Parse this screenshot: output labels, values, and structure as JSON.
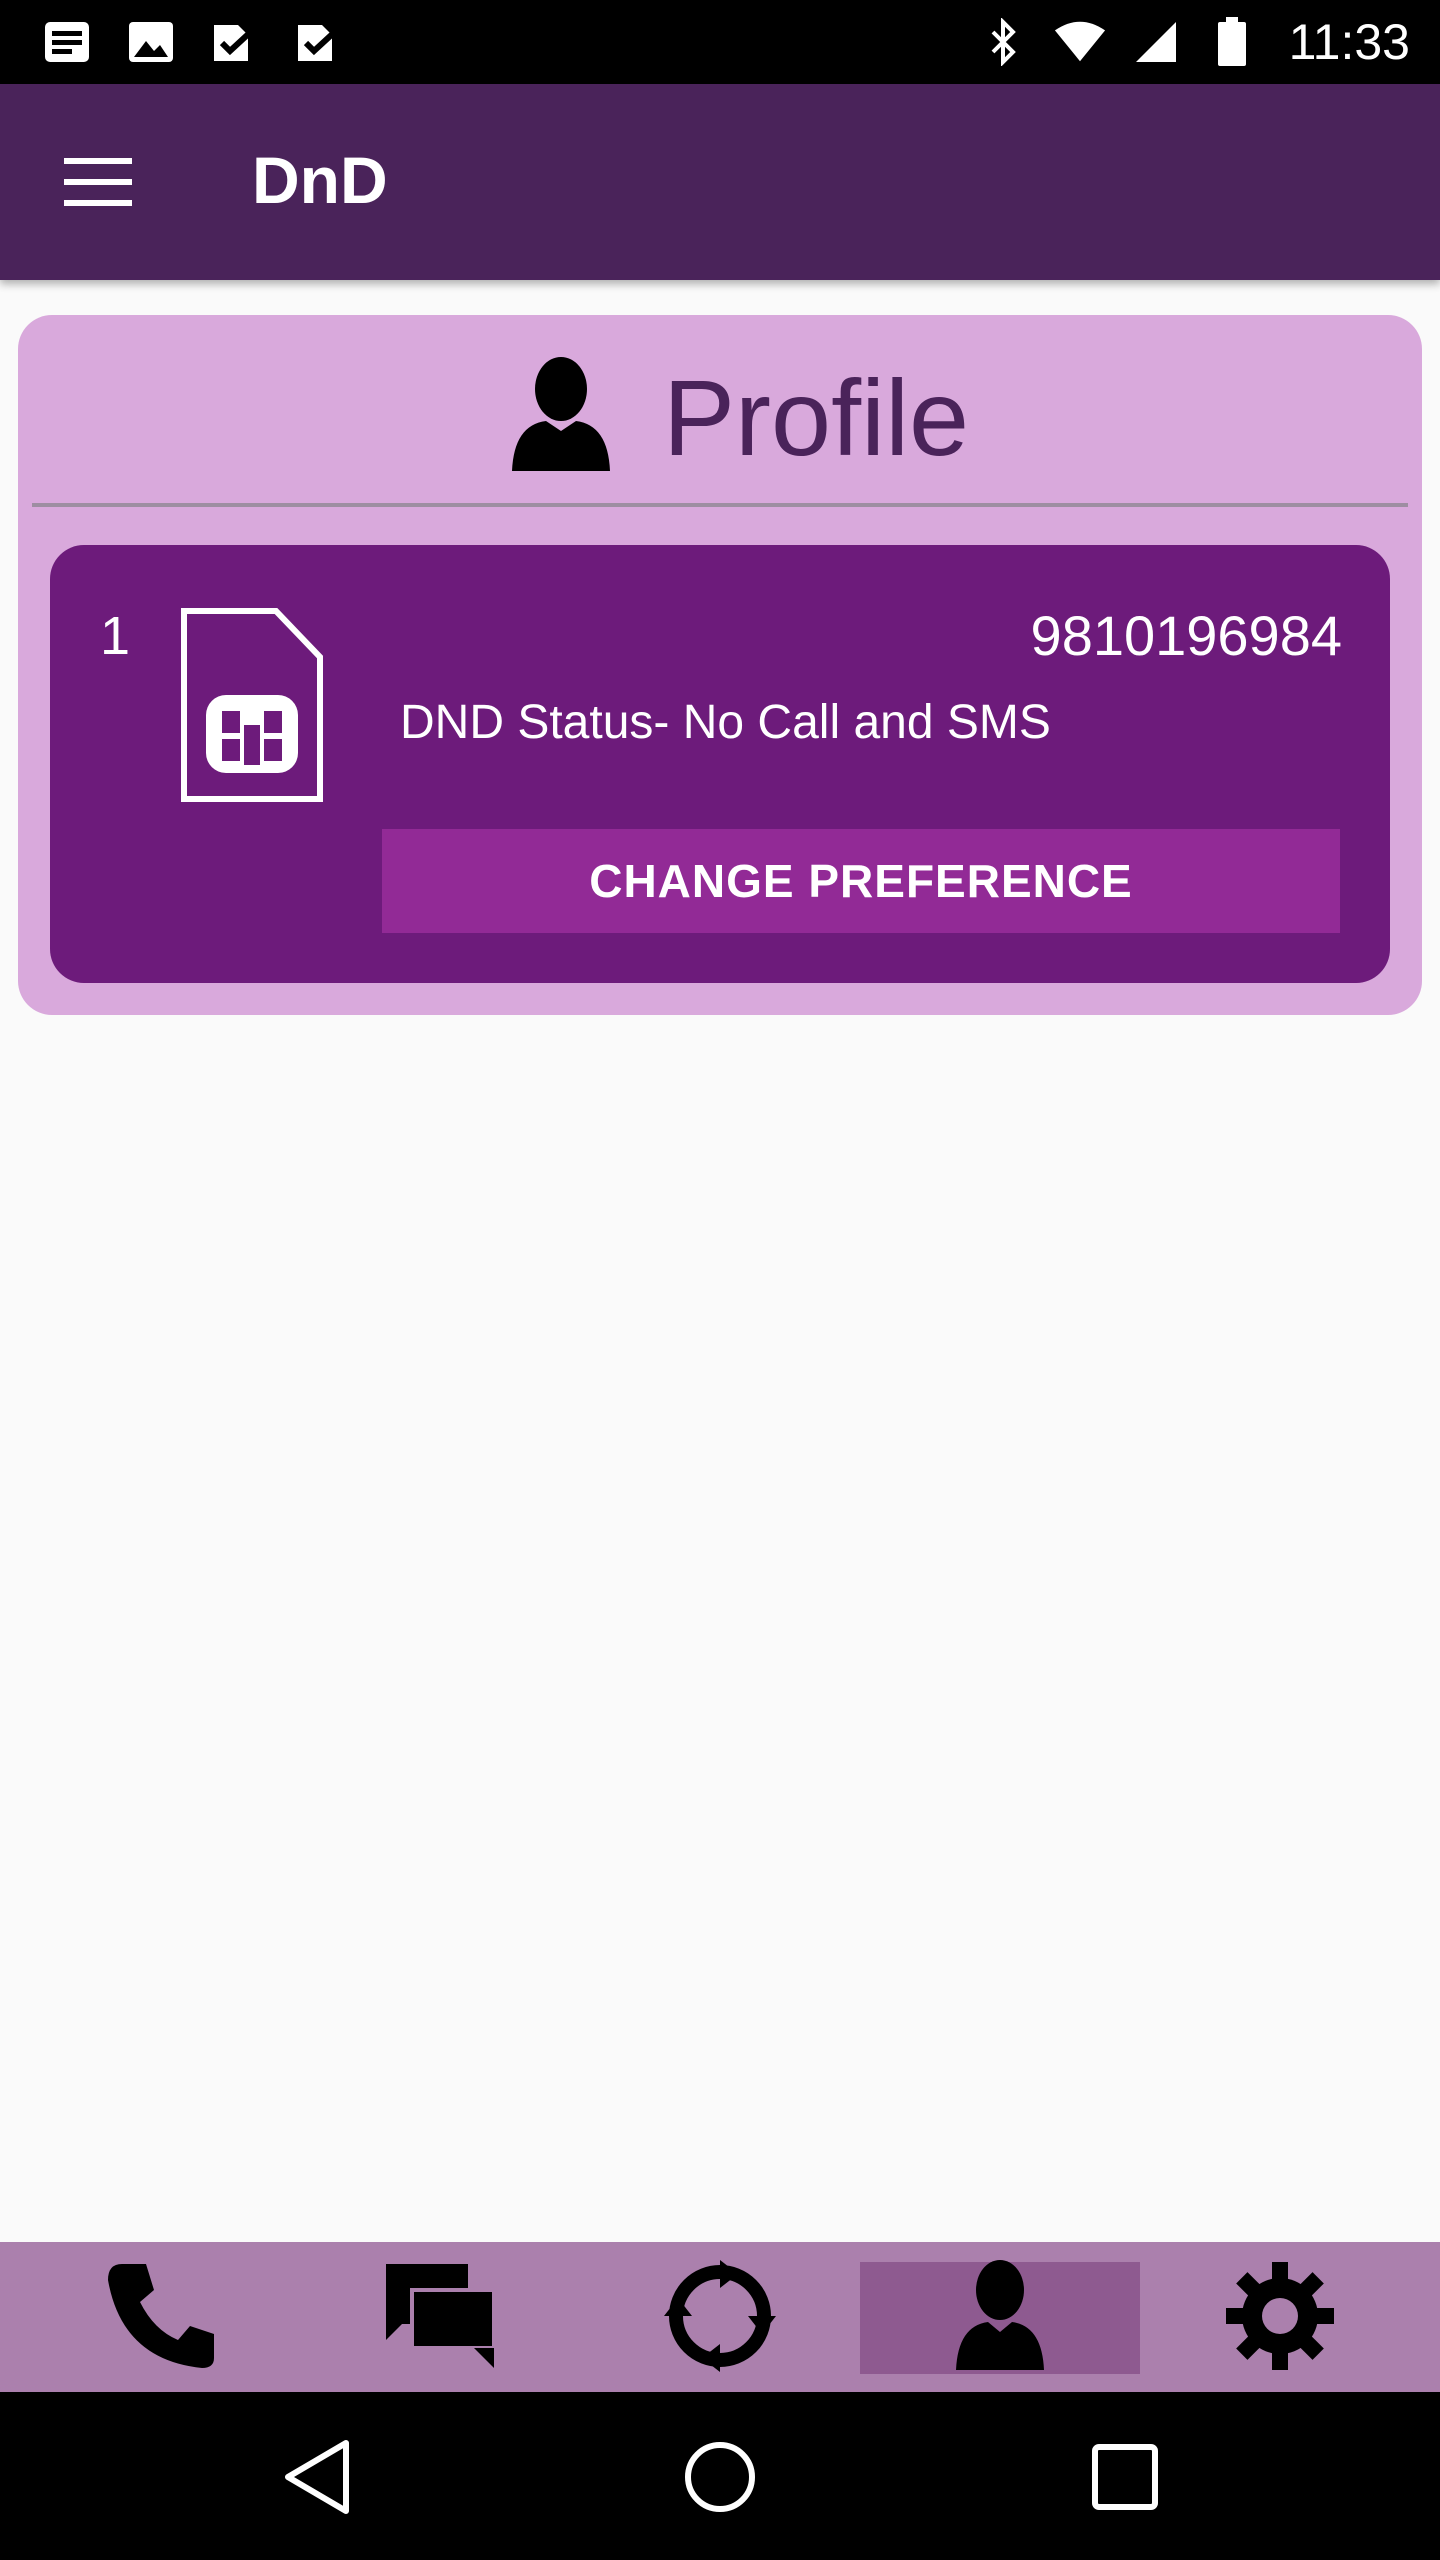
{
  "status_bar": {
    "time": "11:33",
    "left_icons": [
      "news-icon",
      "image-icon",
      "check-icon",
      "check-icon"
    ],
    "right_icons": [
      "bluetooth-icon",
      "wifi-icon",
      "cell-signal-icon",
      "battery-icon"
    ]
  },
  "app_bar": {
    "title": "DnD",
    "menu_icon": "hamburger-menu-icon"
  },
  "profile": {
    "title": "Profile",
    "icon": "person-icon",
    "sims": [
      {
        "index": "1",
        "number": "9810196984",
        "status": "DND Status-  No Call and SMS",
        "button_label": "CHANGE PREFERENCE"
      }
    ]
  },
  "bottom_nav": {
    "items": [
      {
        "icon": "phone-icon",
        "active": false
      },
      {
        "icon": "chat-icon",
        "active": false
      },
      {
        "icon": "refresh-icon",
        "active": false
      },
      {
        "icon": "profile-icon",
        "active": true
      },
      {
        "icon": "settings-icon",
        "active": false
      }
    ]
  },
  "colors": {
    "app_bar": "#4a235a",
    "profile_card": "#d9a9dc",
    "sim_card": "#6d1b7b",
    "button": "#922a96",
    "bottom_nav": "#ab80ad",
    "bottom_nav_active": "#8e5a90"
  }
}
